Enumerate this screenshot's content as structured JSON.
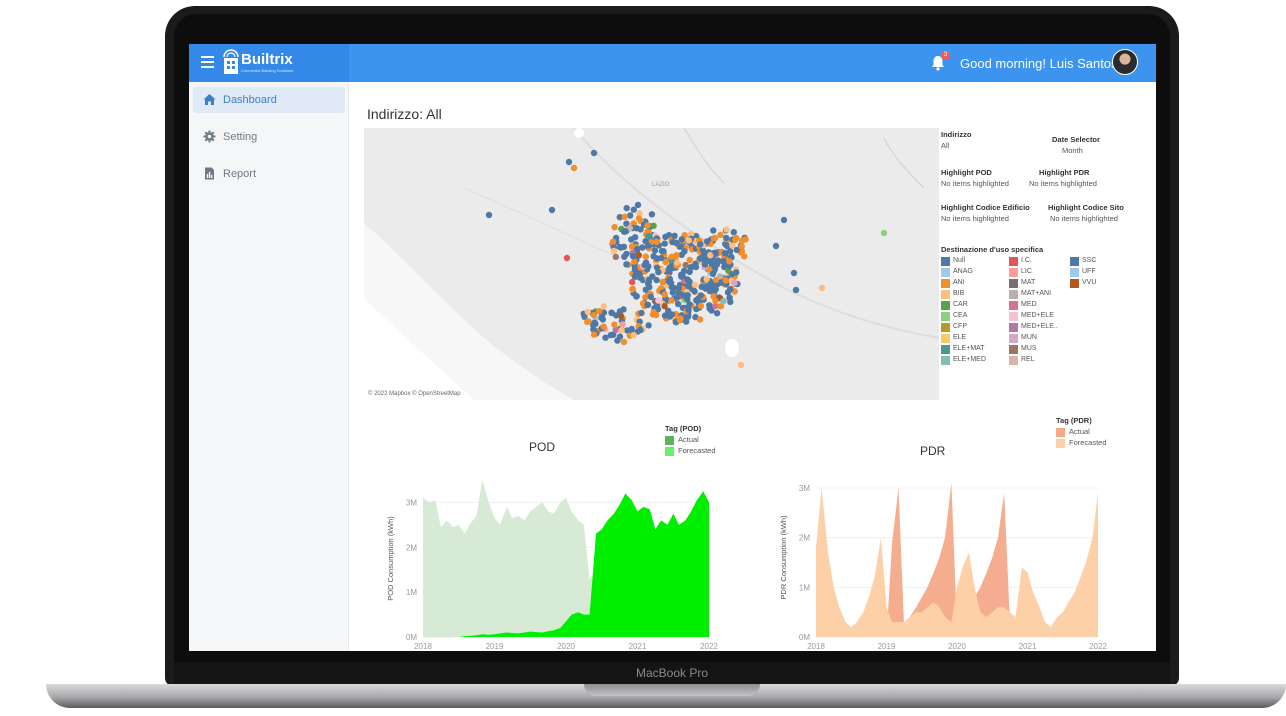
{
  "device": {
    "label": "MacBook Pro"
  },
  "app": {
    "logo_text": "Builtrix",
    "logo_subtitle": "Connected Building Solutions",
    "notifications_count": "3",
    "greeting": "Good morning! Luis Santos"
  },
  "sidebar": {
    "items": [
      {
        "label": "Dashboard",
        "icon": "home-icon",
        "active": true
      },
      {
        "label": "Setting",
        "icon": "gear-icon",
        "active": false
      },
      {
        "label": "Report",
        "icon": "report-icon",
        "active": false
      }
    ]
  },
  "page": {
    "title": "Indirizzo: All"
  },
  "map": {
    "attribution": "© 2022 Mapbox © OpenStreetMap",
    "place_label": "LAZIO"
  },
  "filters": {
    "indirizzo": {
      "title": "Indirizzo",
      "value": "All"
    },
    "date_selector": {
      "title": "Date Selector",
      "value": "Month"
    },
    "highlight_pod": {
      "title": "Highlight POD",
      "value": "No items highlighted"
    },
    "highlight_pdr": {
      "title": "Highlight PDR",
      "value": "No items highlighted"
    },
    "highlight_codice_edificio": {
      "title": "Highlight Codice Edificio",
      "value": "No items highlighted"
    },
    "highlight_codice_sito": {
      "title": "Highlight Codice Sito",
      "value": "No items highlighted"
    }
  },
  "legend": {
    "title": "Destinazione d'uso specifica",
    "items": [
      {
        "label": "Null",
        "color": "#4e79a7"
      },
      {
        "label": "ANAG",
        "color": "#a0cbe8"
      },
      {
        "label": "ANI",
        "color": "#f28e2b"
      },
      {
        "label": "BIB",
        "color": "#ffbe7d"
      },
      {
        "label": "CAR",
        "color": "#59a14f"
      },
      {
        "label": "CEA",
        "color": "#8cd17d"
      },
      {
        "label": "CFP",
        "color": "#b6992d"
      },
      {
        "label": "ELE",
        "color": "#f1ce63"
      },
      {
        "label": "ELE+MAT",
        "color": "#499894"
      },
      {
        "label": "ELE+MED",
        "color": "#86bcb6"
      },
      {
        "label": "I.C.",
        "color": "#e15759"
      },
      {
        "label": "LIC",
        "color": "#ff9d9a"
      },
      {
        "label": "MAT",
        "color": "#79706e"
      },
      {
        "label": "MAT+ANI",
        "color": "#bab0ac"
      },
      {
        "label": "MED",
        "color": "#d37295"
      },
      {
        "label": "MED+ELE",
        "color": "#fabfd2"
      },
      {
        "label": "MED+ELE..",
        "color": "#b07aa1"
      },
      {
        "label": "MUN",
        "color": "#d4a6c8"
      },
      {
        "label": "MUS",
        "color": "#9d7660"
      },
      {
        "label": "REL",
        "color": "#d7b5a6"
      },
      {
        "label": "SSC",
        "color": "#4e79a7"
      },
      {
        "label": "UFF",
        "color": "#a0cbe8"
      },
      {
        "label": "VVU",
        "color": "#b1581d"
      }
    ]
  },
  "chart_data": [
    {
      "type": "area",
      "title": "POD",
      "ylabel": "POD Consumption (kWh)",
      "xlabel": "",
      "x_ticks": [
        "2018",
        "2019",
        "2020",
        "2021",
        "2022"
      ],
      "y_ticks": [
        "0M",
        "1M",
        "2M",
        "3M"
      ],
      "ylim": [
        0,
        3500000
      ],
      "x": [
        2018.0,
        2018.08,
        2018.17,
        2018.25,
        2018.33,
        2018.42,
        2018.5,
        2018.58,
        2018.67,
        2018.75,
        2018.83,
        2018.92,
        2019.0,
        2019.08,
        2019.17,
        2019.25,
        2019.33,
        2019.42,
        2019.5,
        2019.58,
        2019.67,
        2019.75,
        2019.83,
        2019.92,
        2020.0,
        2020.08,
        2020.17,
        2020.25,
        2020.33,
        2020.42,
        2020.5,
        2020.58,
        2020.67,
        2020.75,
        2020.83,
        2020.92,
        2021.0,
        2021.08,
        2021.17,
        2021.25,
        2021.33,
        2021.42,
        2021.5,
        2021.58,
        2021.67,
        2021.75,
        2021.83,
        2021.92,
        2022.0
      ],
      "legend_title": "Tag (POD)",
      "series": [
        {
          "name": "Actual",
          "color": "#d6ead6",
          "values": [
            3100000,
            3000000,
            3050000,
            2450000,
            2600000,
            2450000,
            2500000,
            2300000,
            2550000,
            2700000,
            3500000,
            3000000,
            2650000,
            2500000,
            2900000,
            2650000,
            2700000,
            2600000,
            2800000,
            2900000,
            3000000,
            2800000,
            2750000,
            3000000,
            3100000,
            2800000,
            2600000,
            2500000,
            1300000,
            1350000,
            1300000,
            1400000,
            1500000,
            1600000,
            1800000,
            1900000,
            1800000,
            2100000,
            2200000,
            2100000,
            2500000,
            2400000,
            2300000,
            2200000,
            2400000,
            2200000,
            2500000,
            2600000,
            2700000
          ]
        },
        {
          "name": "Forecasted",
          "color": "#00ee00",
          "values": [
            0,
            0,
            0,
            0,
            0,
            0,
            0,
            20000,
            30000,
            40000,
            60000,
            50000,
            60000,
            80000,
            100000,
            90000,
            80000,
            100000,
            120000,
            110000,
            100000,
            130000,
            150000,
            200000,
            350000,
            500000,
            550000,
            500000,
            500000,
            2300000,
            2400000,
            2600000,
            2750000,
            2950000,
            3200000,
            3050000,
            2800000,
            2900000,
            2850000,
            2400000,
            2600000,
            2500000,
            2750000,
            2500000,
            2600000,
            2800000,
            3050000,
            3250000,
            3000000
          ]
        }
      ]
    },
    {
      "type": "area",
      "title": "PDR",
      "ylabel": "PDR Consumption (kWh)",
      "xlabel": "",
      "x_ticks": [
        "2018",
        "2019",
        "2020",
        "2021",
        "2022"
      ],
      "y_ticks": [
        "0M",
        "1M",
        "2M",
        "3M"
      ],
      "ylim": [
        0,
        3200000
      ],
      "x": [
        2018.0,
        2018.08,
        2018.17,
        2018.25,
        2018.33,
        2018.42,
        2018.5,
        2018.58,
        2018.67,
        2018.75,
        2018.83,
        2018.92,
        2019.0,
        2019.08,
        2019.17,
        2019.25,
        2019.33,
        2019.42,
        2019.5,
        2019.58,
        2019.67,
        2019.75,
        2019.83,
        2019.92,
        2020.0,
        2020.08,
        2020.17,
        2020.25,
        2020.33,
        2020.42,
        2020.5,
        2020.58,
        2020.67,
        2020.75,
        2020.83,
        2020.92,
        2021.0,
        2021.08,
        2021.17,
        2021.25,
        2021.33,
        2021.42,
        2021.5,
        2021.58,
        2021.67,
        2021.75,
        2021.83,
        2021.92,
        2022.0
      ],
      "legend_title": "Tag (PDR)",
      "series": [
        {
          "name": "Actual",
          "color": "#f4a98a",
          "values": [
            0,
            0,
            0,
            0,
            0,
            0,
            0,
            0,
            0,
            0,
            0,
            0,
            0,
            1900000,
            3000000,
            200000,
            400000,
            600000,
            800000,
            1000000,
            1300000,
            1600000,
            2000000,
            3100000,
            200000,
            500000,
            700000,
            800000,
            1000000,
            1300000,
            1600000,
            2000000,
            2900000,
            300000,
            200000,
            0,
            0,
            0,
            0,
            0,
            0,
            0,
            0,
            0,
            0,
            0,
            0,
            0,
            0
          ]
        },
        {
          "name": "Forecasted",
          "color": "#fdd0a8",
          "values": [
            1800000,
            3000000,
            1700000,
            1000000,
            600000,
            300000,
            200000,
            300000,
            500000,
            800000,
            1200000,
            2000000,
            600000,
            300000,
            300000,
            300000,
            400000,
            500000,
            500000,
            600000,
            700000,
            600000,
            400000,
            300000,
            1000000,
            1400000,
            1700000,
            1000000,
            500000,
            400000,
            500000,
            600000,
            600000,
            500000,
            400000,
            1400000,
            1300000,
            900000,
            600000,
            300000,
            200000,
            400000,
            500000,
            700000,
            900000,
            1200000,
            1500000,
            2000000,
            2900000
          ]
        }
      ]
    }
  ]
}
